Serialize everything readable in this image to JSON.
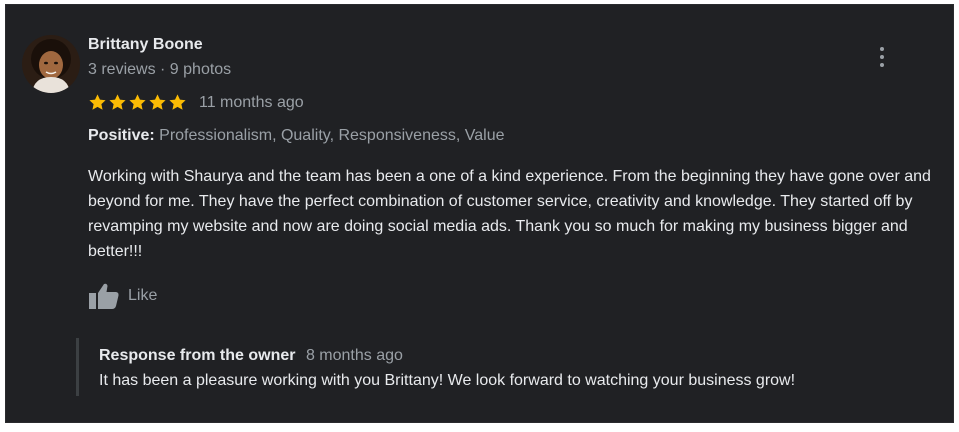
{
  "reviewer": {
    "name": "Brittany Boone",
    "meta": "3 reviews · 9 photos"
  },
  "rating": {
    "stars": 5,
    "max": 5,
    "time": "11 months ago"
  },
  "positive": {
    "label": "Positive:",
    "values": "Professionalism, Quality, Responsiveness, Value"
  },
  "review": {
    "text": "Working with Shaurya and the team has been a one of a kind experience. From the beginning they have gone over and beyond for me. They have the perfect combination of customer service, creativity and knowledge. They started off by revamping my website and now are doing social media ads. Thank you so much for making my business bigger and better!!!"
  },
  "actions": {
    "like_label": "Like"
  },
  "owner_response": {
    "title": "Response from the owner",
    "time": "8 months ago",
    "text": "It has been a pleasure working with you Brittany! We look forward to watching your business grow!"
  },
  "colors": {
    "card_background": "#202124",
    "star": "#fbbc04",
    "primary_text": "#e8eaed",
    "secondary_text": "#9aa0a6"
  },
  "icons": {
    "avatar": "avatar",
    "more": "more-vert-icon",
    "star": "star-icon",
    "like": "thumbs-up-icon"
  }
}
